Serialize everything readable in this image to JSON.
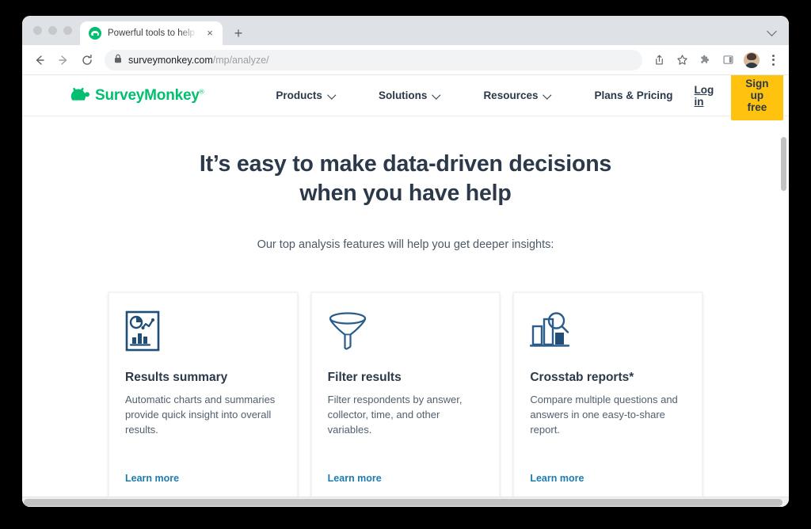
{
  "browser": {
    "tab": {
      "title": "Powerful tools to help you anal",
      "favicon": "surveymonkey-favicon",
      "close_label": "×"
    },
    "new_tab_label": "+",
    "toolbar": {
      "back_icon": "back-arrow-icon",
      "forward_icon": "forward-arrow-icon",
      "reload_icon": "reload-icon",
      "lock_icon": "lock-icon",
      "url_domain": "surveymonkey.com",
      "url_path": "/mp/analyze/",
      "share_icon": "share-icon",
      "bookmark_icon": "star-icon",
      "extensions_icon": "puzzle-piece-icon",
      "sidepanel_icon": "side-panel-icon",
      "avatar_icon": "profile-avatar",
      "menu_icon": "three-dot-menu-icon",
      "tabsearch_icon": "chevron-down-icon"
    }
  },
  "site": {
    "nav": {
      "logo_text": "SurveyMonkey",
      "logo_registered": "®",
      "links": [
        {
          "label": "Products",
          "has_caret": true
        },
        {
          "label": "Solutions",
          "has_caret": true
        },
        {
          "label": "Resources",
          "has_caret": true
        },
        {
          "label": "Plans & Pricing",
          "has_caret": false
        }
      ],
      "login_label": "Log in",
      "signup_label": "Sign up free",
      "signup_color": "#ffc20e"
    },
    "hero": {
      "headline_line1": "It’s easy to make data-driven decisions",
      "headline_line2": "when you have help",
      "subhead": "Our top analysis features will help you get deeper insights:"
    },
    "cards": [
      {
        "icon": "results-summary-report-icon",
        "title": "Results summary",
        "description": "Automatic charts and summaries provide quick insight into overall results.",
        "link_label": "Learn more"
      },
      {
        "icon": "funnel-filter-icon",
        "title": "Filter results",
        "description": "Filter respondents by answer, collector, time, and other variables.",
        "link_label": "Learn more"
      },
      {
        "icon": "bar-chart-magnifier-icon",
        "title": "Crosstab reports*",
        "description": "Compare multiple questions and answers in one easy-to-share report.",
        "link_label": "Learn more"
      }
    ],
    "colors": {
      "brand_green": "#00bf6f",
      "accent_yellow": "#ffc20e",
      "text_dark": "#2b394a",
      "link_blue": "#1c7cae",
      "icon_blue": "#1f4e79"
    }
  }
}
